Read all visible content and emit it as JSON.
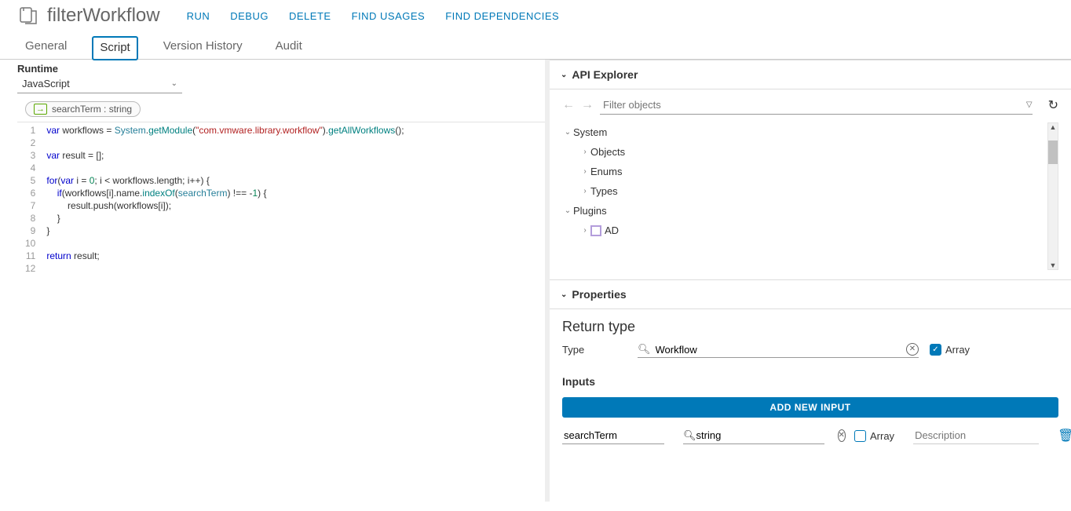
{
  "header": {
    "title": "filterWorkflow",
    "actions": [
      "RUN",
      "DEBUG",
      "DELETE",
      "FIND USAGES",
      "FIND DEPENDENCIES"
    ]
  },
  "tabs": [
    "General",
    "Script",
    "Version History",
    "Audit"
  ],
  "active_tab": "Script",
  "runtime": {
    "label": "Runtime",
    "value": "JavaScript"
  },
  "param_pill": {
    "name": "searchTerm",
    "type": "string"
  },
  "code": {
    "lines": [
      "1",
      "2",
      "3",
      "4",
      "5",
      "6",
      "7",
      "8",
      "9",
      "10",
      "11",
      "12"
    ],
    "l1_var": "var",
    "l1_a": " workflows = ",
    "l1_sys": "System",
    "l1_b": ".",
    "l1_gm": "getModule",
    "l1_c": "(",
    "l1_str": "\"com.vmware.library.workflow\"",
    "l1_d": ").",
    "l1_gw": "getAllWorkflows",
    "l1_e": "();",
    "l3_var": "var",
    "l3_rest": " result = [];",
    "l5_for": "for",
    "l5_a": "(",
    "l5_var": "var",
    "l5_b": " i = ",
    "l5_zero": "0",
    "l5_c": "; i < workflows.length; i++) {",
    "l6_a": "    ",
    "l6_if": "if",
    "l6_b": "(workflows[i].name.",
    "l6_idx": "indexOf",
    "l6_c": "(",
    "l6_st": "searchTerm",
    "l6_d": ") !== -",
    "l6_one": "1",
    "l6_e": ") {",
    "l7": "        result.push(workflows[i]);",
    "l8": "    }",
    "l9": "}",
    "l11_ret": "return",
    "l11_rest": " result;"
  },
  "api": {
    "title": "API Explorer",
    "filter_placeholder": "Filter objects",
    "tree": {
      "system": "System",
      "objects": "Objects",
      "enums": "Enums",
      "types": "Types",
      "plugins": "Plugins",
      "ad": "AD"
    }
  },
  "properties": {
    "title": "Properties",
    "return_type": "Return type",
    "type_label": "Type",
    "type_value": "Workflow",
    "array_label": "Array",
    "inputs_title": "Inputs",
    "add_btn": "ADD NEW INPUT",
    "input_name": "searchTerm",
    "input_type": "string",
    "input_array_label": "Array",
    "desc_placeholder": "Description"
  }
}
